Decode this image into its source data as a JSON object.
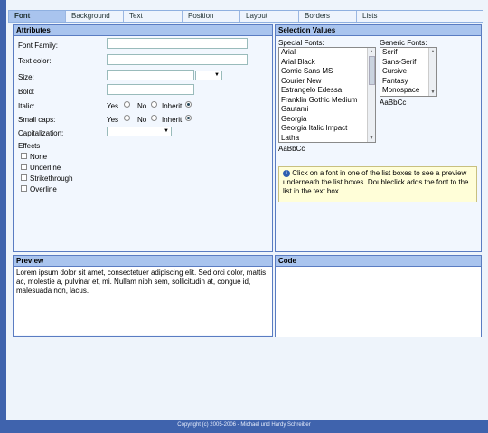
{
  "tabs": [
    "Font",
    "Background",
    "Text",
    "Position",
    "Layout",
    "Borders",
    "Lists"
  ],
  "attributes": {
    "title": "Attributes",
    "font_family_label": "Font Family:",
    "text_color_label": "Text color:",
    "size_label": "Size:",
    "bold_label": "Bold:",
    "italic_label": "Italic:",
    "small_caps_label": "Small caps:",
    "capitalization_label": "Capitalization:",
    "effects_label": "Effects",
    "yes": "Yes",
    "no": "No",
    "inherit": "Inherit",
    "effects": [
      "None",
      "Underline",
      "Strikethrough",
      "Overline"
    ]
  },
  "selection": {
    "title": "Selection Values",
    "special_label": "Special Fonts:",
    "generic_label": "Generic Fonts:",
    "special_fonts": [
      "Arial",
      "Arial Black",
      "Comic Sans MS",
      "Courier New",
      "Estrangelo Edessa",
      "Franklin Gothic Medium",
      "Gautami",
      "Georgia",
      "Georgia Italic Impact",
      "Latha"
    ],
    "generic_fonts": [
      "Serif",
      "Sans-Serif",
      "Cursive",
      "Fantasy",
      "Monospace"
    ],
    "sample": "AaBbCc",
    "info_text": "Click on a font in one of the list boxes to see a preview underneath the list boxes. Doubleclick adds the font to the list in the text box."
  },
  "preview": {
    "title": "Preview",
    "text": "Lorem ipsum dolor sit amet, consectetuer adipiscing elit. Sed orci dolor, mattis ac, molestie a, pulvinar et, mi. Nullam nibh sem, sollicitudin at, congue id, malesuada non, lacus."
  },
  "code": {
    "title": "Code"
  },
  "footer": "Copyright (c) 2005-2006 - Michael und Hardy Schreiber"
}
